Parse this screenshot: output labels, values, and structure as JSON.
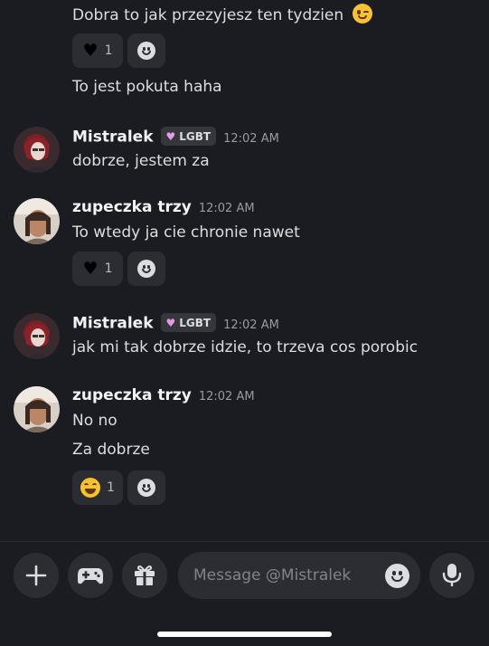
{
  "messages": {
    "m1_text": "Dobra to jak przezyjesz ten tydzien",
    "m1_reaction_count": "1",
    "m2_text": "To jest pokuta haha",
    "g1_author": "Mistralek",
    "g1_badge": "LGBT",
    "g1_time": "12:02 AM",
    "g1_text": "dobrze, jestem za",
    "g2_author": "zupeczka trzy",
    "g2_time": "12:02 AM",
    "g2_text": "To wtedy ja cie chronie nawet",
    "g2_reaction_count": "1",
    "g3_author": "Mistralek",
    "g3_badge": "LGBT",
    "g3_time": "12:02 AM",
    "g3_text": "jak mi tak dobrze idzie, to trzeva cos porobic",
    "g4_author": "zupeczka trzy",
    "g4_time": "12:02 AM",
    "g4_text1": "No no",
    "g4_text2": "Za dobrze",
    "g4_reaction_count": "1"
  },
  "composer": {
    "placeholder": "Message @Mistralek"
  },
  "icons": {
    "wink": "wink-emoji-icon",
    "black_heart": "black-heart-icon",
    "add_reaction": "add-reaction-icon",
    "laugh": "laughing-emoji-icon",
    "plus": "plus-icon",
    "gamepad": "gamepad-icon",
    "gift": "gift-icon",
    "emoji": "emoji-icon",
    "mic": "microphone-icon"
  },
  "colors": {
    "background": "#1b1c21",
    "pill": "#2b2d33",
    "badge_heart": "#e49ae8"
  }
}
